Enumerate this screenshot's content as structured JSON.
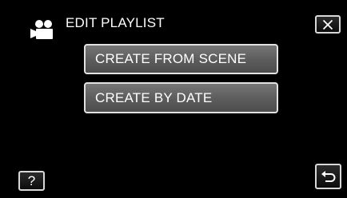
{
  "header": {
    "title": "EDIT PLAYLIST",
    "mode_icon": "video-camera-icon",
    "close_icon": "close-icon"
  },
  "menu": {
    "items": [
      {
        "label": "CREATE FROM SCENE"
      },
      {
        "label": "CREATE BY DATE"
      }
    ]
  },
  "footer": {
    "help_label": "?",
    "back_icon": "return-arrow-icon"
  }
}
